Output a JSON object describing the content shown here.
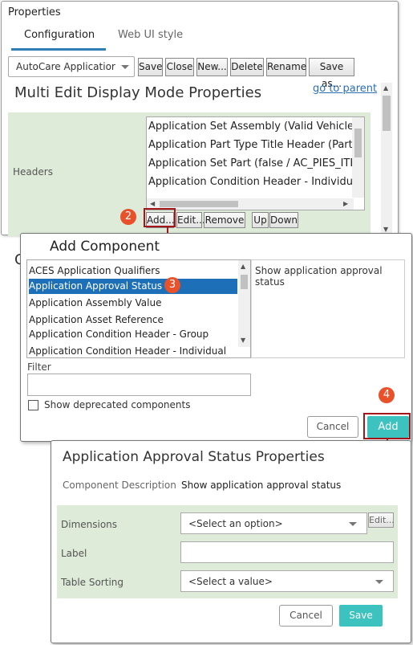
{
  "properties": {
    "title": "Properties",
    "tabs": [
      {
        "label": "Configuration"
      },
      {
        "label": "Web UI style"
      }
    ],
    "toolbar": {
      "config_select": "AutoCare Applicatior",
      "buttons": [
        "Save",
        "Close",
        "New...",
        "Delete",
        "Rename",
        "Save as..."
      ]
    },
    "mode_title": "Multi Edit Display Mode Properties",
    "goto_parent": "go to parent",
    "headers_label": "Headers",
    "headers_list": [
      "Application Set Assembly (Valid Vehicle /",
      "Application Part Type Title Header (Part T",
      "Application Set Part (false / AC_PIES_ITEM",
      "Application Condition Header - Individual"
    ],
    "list_buttons": [
      "Add...",
      "Edit...",
      "Remove",
      "Up",
      "Down"
    ],
    "partial_heading": "C"
  },
  "callouts": {
    "c2": "2",
    "c3": "3",
    "c4": "4"
  },
  "add_component": {
    "title": "Add Component",
    "items": [
      "ACES Application Qualifiers",
      "Application Approval Status",
      "Application Assembly Value",
      "Application Asset Reference",
      "Application Condition Header - Group",
      "Application Condition Header - Individual"
    ],
    "selected_index": 1,
    "description": "Show application approval status",
    "filter_label": "Filter",
    "filter_value": "",
    "show_deprecated_label": "Show deprecated components",
    "show_deprecated_checked": false,
    "cancel_label": "Cancel",
    "add_label": "Add"
  },
  "approval_props": {
    "title": "Application Approval Status Properties",
    "component_description_label": "Component Description",
    "component_description_value": "Show application approval status",
    "dimensions_label": "Dimensions",
    "dimensions_value": "<Select an option>",
    "edit_label": "Edit...",
    "label_label": "Label",
    "label_value": "",
    "table_sorting_label": "Table Sorting",
    "table_sorting_value": "<Select a value>",
    "cancel_label": "Cancel",
    "save_label": "Save"
  },
  "colors": {
    "accent": "#3cc2bf",
    "selection": "#1d6fb8",
    "callout": "#e8512a",
    "highlight_box": "#a5161b",
    "section_bg": "#deebd9"
  }
}
